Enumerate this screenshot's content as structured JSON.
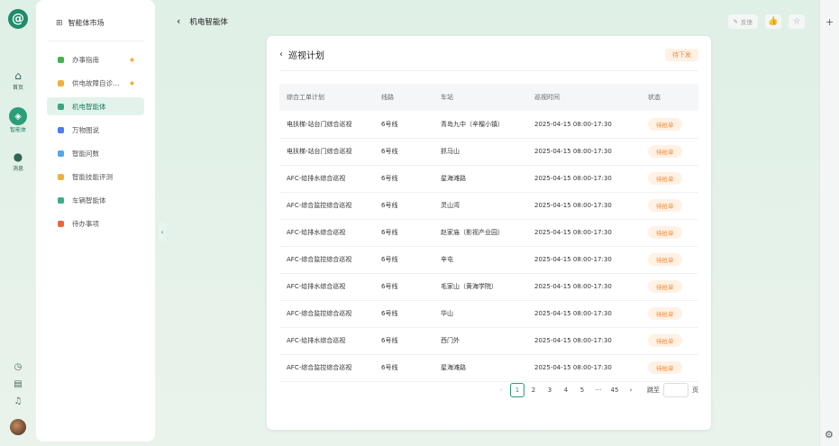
{
  "rail": {
    "items": [
      {
        "label": "首页",
        "icon": "home-icon"
      },
      {
        "label": "智能体",
        "icon": "agent-icon"
      },
      {
        "label": "消息",
        "icon": "message-icon"
      }
    ]
  },
  "side": {
    "title": "智能体市场",
    "items": [
      {
        "label": "办事指南",
        "color": "#4caf50",
        "starred": true
      },
      {
        "label": "供电故障自诊…",
        "color": "#f0b040",
        "starred": true
      },
      {
        "label": "机电智能体",
        "color": "#3aa57f",
        "starred": false
      },
      {
        "label": "万物图说",
        "color": "#4f7cf0",
        "starred": false
      },
      {
        "label": "智能问数",
        "color": "#56a6e8",
        "starred": false
      },
      {
        "label": "智能技能评测",
        "color": "#f0b040",
        "starred": false
      },
      {
        "label": "车辆智能体",
        "color": "#3ab08a",
        "starred": false
      },
      {
        "label": "待办事项",
        "color": "#e8683a",
        "starred": false
      }
    ]
  },
  "topbar": {
    "title": "机电智能体",
    "feedback": "反馈"
  },
  "card": {
    "title": "巡视计划",
    "badge": "待下发",
    "columns": [
      "综合工单计划",
      "线路",
      "车站",
      "巡视时间",
      "状态"
    ],
    "rows": [
      [
        "电扶梯-站台门综合巡视",
        "6号线",
        "青岛九中（辛榴小镇）",
        "2025-04-15 08:00-17:30",
        "待抢单"
      ],
      [
        "电扶梯-站台门综合巡视",
        "6号线",
        "抓马山",
        "2025-04-15 08:00-17:30",
        "待抢单"
      ],
      [
        "AFC-给排水综合巡视",
        "6号线",
        "星海滩路",
        "2025-04-15 08:00-17:30",
        "待抢单"
      ],
      [
        "AFC-综合监控综合巡视",
        "6号线",
        "灵山湾",
        "2025-04-15 08:00-17:30",
        "待抢单"
      ],
      [
        "AFC-给排水综合巡视",
        "6号线",
        "赵家庙（影视产业园）",
        "2025-04-15 08:00-17:30",
        "待抢单"
      ],
      [
        "AFC-综合监控综合巡视",
        "6号线",
        "辛屯",
        "2025-04-15 08:00-17:30",
        "待抢单"
      ],
      [
        "AFC-给排水综合巡视",
        "6号线",
        "毛家山（黄海学院）",
        "2025-04-15 08:00-17:30",
        "待抢单"
      ],
      [
        "AFC-综合监控综合巡视",
        "6号线",
        "华山",
        "2025-04-15 08:00-17:30",
        "待抢单"
      ],
      [
        "AFC-给排水综合巡视",
        "6号线",
        "西门外",
        "2025-04-15 08:00-17:30",
        "待抢单"
      ],
      [
        "AFC-综合监控综合巡视",
        "6号线",
        "星海滩路",
        "2025-04-15 08:00-17:30",
        "待抢单"
      ]
    ]
  },
  "pager": {
    "pages": [
      "1",
      "2",
      "3",
      "4",
      "5",
      "···",
      "45"
    ],
    "current": "1",
    "jump_label": "跳至",
    "page_label": "页"
  },
  "colors": {
    "accent": "#2a9d79",
    "pending": "#f08b3a"
  }
}
